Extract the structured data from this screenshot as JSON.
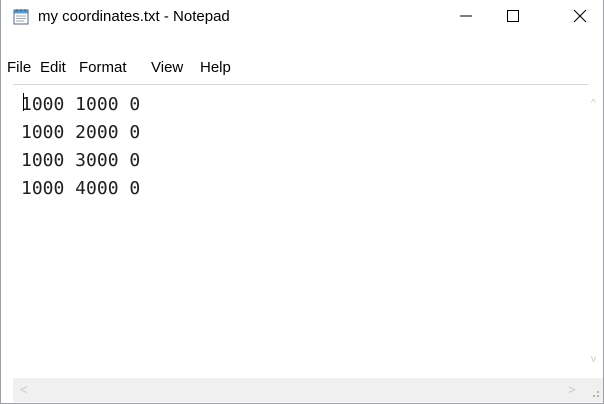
{
  "window": {
    "title": "my coordinates.txt - Notepad",
    "app_icon": "notepad-icon",
    "controls": {
      "minimize_glyph": "—",
      "maximize_glyph": "☐",
      "close_glyph": "✕"
    }
  },
  "menu": {
    "items": [
      {
        "label": "File"
      },
      {
        "label": "Edit"
      },
      {
        "label": "Format"
      },
      {
        "label": "View"
      },
      {
        "label": "Help"
      }
    ]
  },
  "editor": {
    "content": "1000 1000 0\n1000 2000 0\n1000 3000 0\n1000 4000 0",
    "lines": [
      "1000 1000 0",
      "1000 2000 0",
      "1000 3000 0",
      "1000 4000 0"
    ]
  },
  "scrollbars": {
    "up_glyph": "^",
    "down_glyph": "v",
    "left_glyph": "<",
    "right_glyph": ">"
  }
}
